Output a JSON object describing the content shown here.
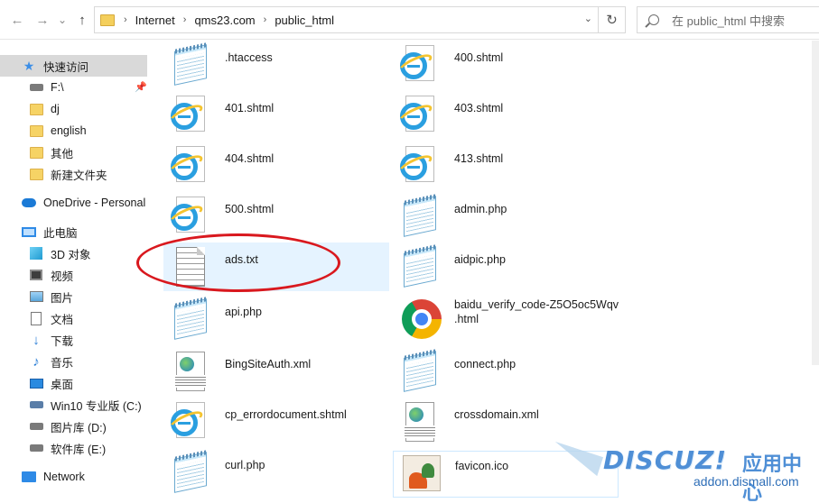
{
  "address": {
    "crumbs": [
      "Internet",
      "qms23.com",
      "public_html"
    ],
    "search_placeholder": "在 public_html 中搜索"
  },
  "nav": {
    "back": "←",
    "forward": "→",
    "recent": "⌄",
    "up": "↑",
    "refresh": "↻",
    "dropdown": "⌄"
  },
  "sidebar": {
    "quick_access": "快速访问",
    "quick_items": [
      "F:\\",
      "dj",
      "english",
      "其他",
      "新建文件夹"
    ],
    "onedrive": "OneDrive - Personal",
    "this_pc": "此电脑",
    "pc_items": [
      "3D 对象",
      "视频",
      "图片",
      "文档",
      "下载",
      "音乐",
      "桌面",
      "Win10 专业版 (C:)",
      "图片库 (D:)",
      "软件库 (E:)"
    ],
    "network": "Network"
  },
  "files": [
    {
      "name": ".htaccess",
      "icon": "notepad-icon"
    },
    {
      "name": "400.shtml",
      "icon": "ie-icon"
    },
    {
      "name": "401.shtml",
      "icon": "ie-icon"
    },
    {
      "name": "403.shtml",
      "icon": "ie-icon"
    },
    {
      "name": "404.shtml",
      "icon": "ie-icon"
    },
    {
      "name": "413.shtml",
      "icon": "ie-icon"
    },
    {
      "name": "500.shtml",
      "icon": "ie-icon"
    },
    {
      "name": "admin.php",
      "icon": "notepad-icon"
    },
    {
      "name": "ads.txt",
      "icon": "text-file-icon"
    },
    {
      "name": "aidpic.php",
      "icon": "notepad-icon"
    },
    {
      "name": "api.php",
      "icon": "notepad-icon"
    },
    {
      "name_line1": "baidu_verify_code-Z5O5oc5Wqv",
      "name_line2": ".html",
      "icon": "chrome-icon"
    },
    {
      "name": "BingSiteAuth.xml",
      "icon": "xml-icon"
    },
    {
      "name": "connect.php",
      "icon": "notepad-icon"
    },
    {
      "name": "cp_errordocument.shtml",
      "icon": "ie-icon"
    },
    {
      "name": "crossdomain.xml",
      "icon": "xml-icon"
    },
    {
      "name": "curl.php",
      "icon": "notepad-icon"
    },
    {
      "name": "favicon.ico",
      "icon": "favicon-icon"
    }
  ],
  "watermark": {
    "logo": "DISCUZ!",
    "cn": "应用中心",
    "url": "addon.dismall.com"
  },
  "colors": {
    "accent": "#0078d7",
    "selection": "#cce8ff",
    "annotation": "#d9181e"
  }
}
